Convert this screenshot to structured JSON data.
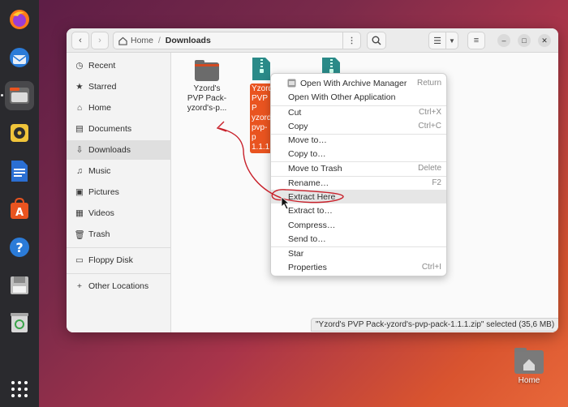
{
  "path": {
    "home": "Home",
    "current": "Downloads"
  },
  "sidebar": {
    "items": [
      {
        "label": "Recent",
        "icon": "clock-icon"
      },
      {
        "label": "Starred",
        "icon": "star-icon"
      },
      {
        "label": "Home",
        "icon": "home-icon"
      },
      {
        "label": "Documents",
        "icon": "document-icon"
      },
      {
        "label": "Downloads",
        "icon": "download-icon"
      },
      {
        "label": "Music",
        "icon": "music-icon"
      },
      {
        "label": "Pictures",
        "icon": "picture-icon"
      },
      {
        "label": "Videos",
        "icon": "video-icon"
      },
      {
        "label": "Trash",
        "icon": "trash-icon"
      },
      {
        "label": "Floppy Disk",
        "icon": "disk-icon"
      },
      {
        "label": "Other Locations",
        "icon": "plus-icon"
      }
    ]
  },
  "files": [
    {
      "name_line1": "Yzord's",
      "name_line2": "PVP Pack-",
      "name_line3": "yzord's-p...",
      "type": "folder"
    },
    {
      "name_line1": "Yzord",
      "name_line2": "PVP P",
      "name_line3": "yzord",
      "name_line4": "pvp-p",
      "name_line5": "1.1.1",
      "type": "zip",
      "selected": true
    },
    {
      "type": "zip"
    }
  ],
  "menu": {
    "items": [
      {
        "label": "Open With Archive Manager",
        "accel": "Return"
      },
      {
        "label": "Open With Other Application",
        "accel": ""
      },
      {
        "label": "Cut",
        "accel": "Ctrl+X"
      },
      {
        "label": "Copy",
        "accel": "Ctrl+C"
      },
      {
        "label": "Move to…",
        "accel": ""
      },
      {
        "label": "Copy to…",
        "accel": ""
      },
      {
        "label": "Move to Trash",
        "accel": "Delete"
      },
      {
        "label": "Rename…",
        "accel": "F2"
      },
      {
        "label": "Extract Here",
        "accel": ""
      },
      {
        "label": "Extract to…",
        "accel": ""
      },
      {
        "label": "Compress…",
        "accel": ""
      },
      {
        "label": "Send to…",
        "accel": ""
      },
      {
        "label": "Star",
        "accel": ""
      },
      {
        "label": "Properties",
        "accel": "Ctrl+I"
      }
    ]
  },
  "status": {
    "text": "\"Yzord's PVP Pack-yzord's-pvp-pack-1.1.1.zip\" selected  (35,6 MB)"
  },
  "desktop": {
    "home_label": "Home"
  },
  "colors": {
    "accent": "#e95420",
    "zip_teal": "#2a8a88",
    "folder": "#6b6b6b"
  }
}
